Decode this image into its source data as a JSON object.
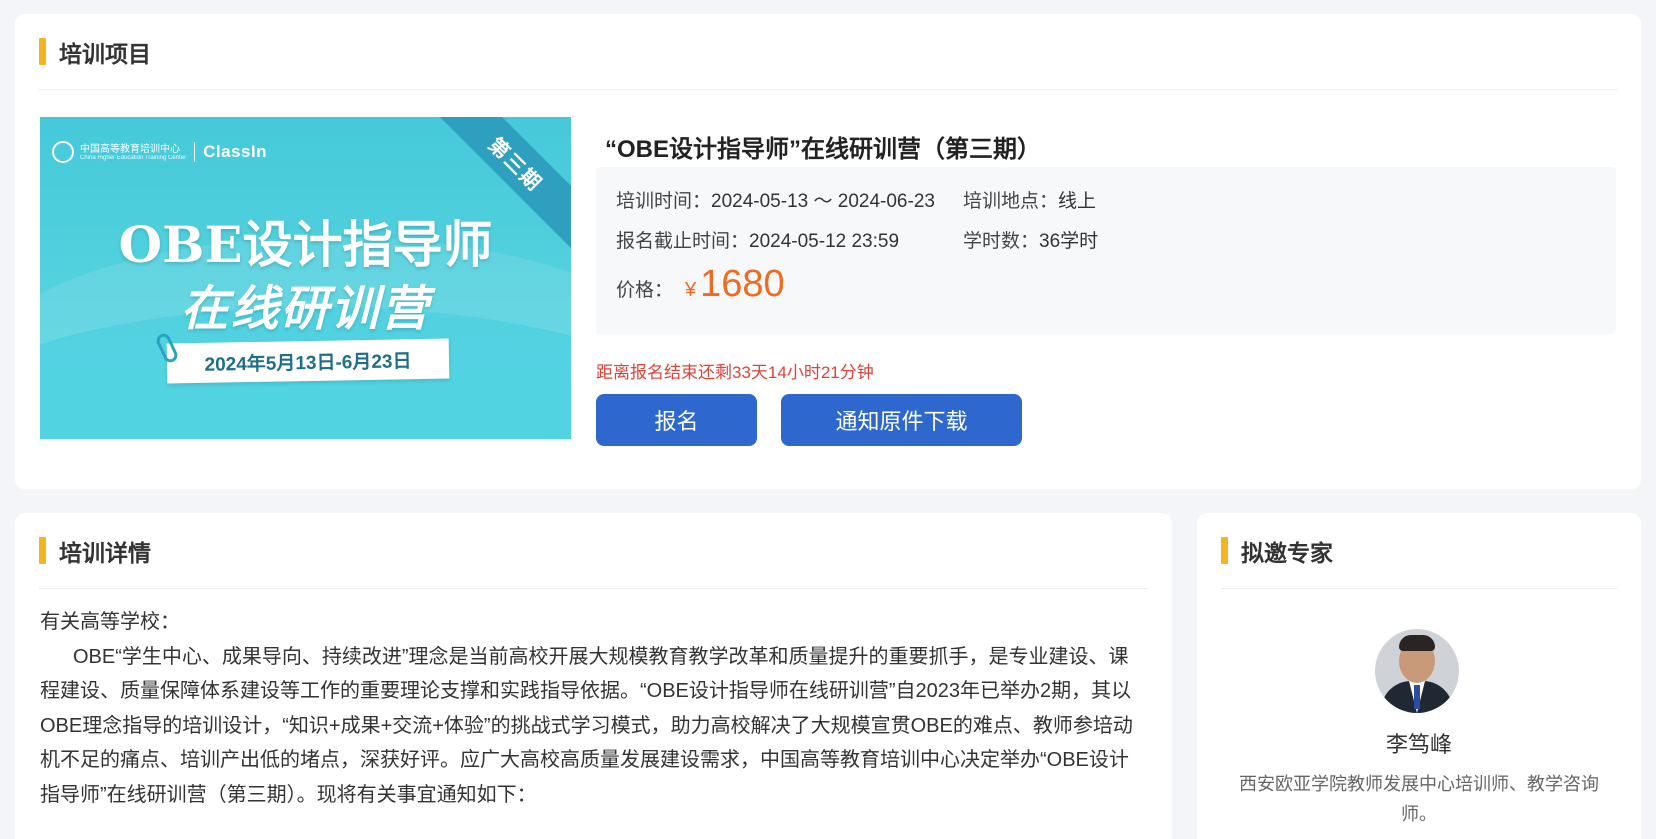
{
  "project": {
    "section_title": "培训项目",
    "banner": {
      "org_name": "中国高等教育培训中心",
      "org_name_en": "China Higher Education Training Center",
      "brand": "ClassIn",
      "ribbon": "第三期",
      "title_line1": "OBE设计指导师",
      "title_line2": "在线研训营",
      "date_range": "2024年5月13日-6月23日"
    },
    "course_title": "“OBE设计指导师”在线研训营（第三期）",
    "training_time_label": "培训时间：",
    "training_time_value": "2024-05-13 ～ 2024-06-23",
    "location_label": "培训地点：",
    "location_value": "线上",
    "deadline_label": "报名截止时间：",
    "deadline_value": "2024-05-12 23:59",
    "hours_label": "学时数：",
    "hours_value": "36学时",
    "price_label": "价格：",
    "price_currency": "¥",
    "price_value": "1680",
    "countdown": "距离报名结束还剩33天14小时21分钟",
    "enroll_button": "报名",
    "download_button": "通知原件下载",
    "accent_color": "#2e68cf",
    "price_color": "#f16a21",
    "countdown_color": "#e2413a"
  },
  "details": {
    "section_title": "培训详情",
    "greeting": "有关高等学校：",
    "paragraph": "OBE“学生中心、成果导向、持续改进”理念是当前高校开展大规模教育教学改革和质量提升的重要抓手，是专业建设、课程建设、质量保障体系建设等工作的重要理论支撑和实践指导依据。“OBE设计指导师在线研训营”自2023年已举办2期，其以OBE理念指导的培训设计，“知识+成果+交流+体验”的挑战式学习模式，助力高校解决了大规模宣贯OBE的难点、教师参培动机不足的痛点、培训产出低的堵点，深获好评。应广大高校高质量发展建设需求，中国高等教育培训中心决定举办“OBE设计指导师”在线研训营（第三期）。现将有关事宜通知如下："
  },
  "experts": {
    "section_title": "拟邀专家",
    "name": "李笃峰",
    "description": "西安欧亚学院教师发展中心培训师、教学咨询师。"
  }
}
